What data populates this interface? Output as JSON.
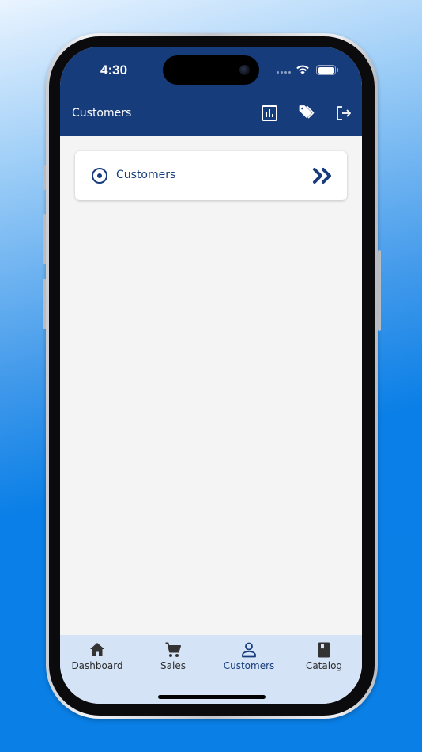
{
  "status_bar": {
    "time": "4:30"
  },
  "header": {
    "title": "Customers",
    "actions": [
      {
        "icon": "bar-chart-icon"
      },
      {
        "icon": "tags-icon"
      },
      {
        "icon": "logout-icon"
      }
    ]
  },
  "content": {
    "items": [
      {
        "label": "Customers",
        "icon": "radio-selected-icon",
        "trailing_icon": "double-chevron-right-icon"
      }
    ]
  },
  "bottom_nav": {
    "items": [
      {
        "label": "Dashboard",
        "icon": "home-icon"
      },
      {
        "label": "Sales",
        "icon": "cart-icon"
      },
      {
        "label": "Customers",
        "icon": "person-icon"
      },
      {
        "label": "Catalog",
        "icon": "book-icon"
      }
    ],
    "active_index": 2
  },
  "colors": {
    "primary": "#173c7c",
    "background": "#f4f4f4",
    "nav_background": "#d5e3f7"
  }
}
